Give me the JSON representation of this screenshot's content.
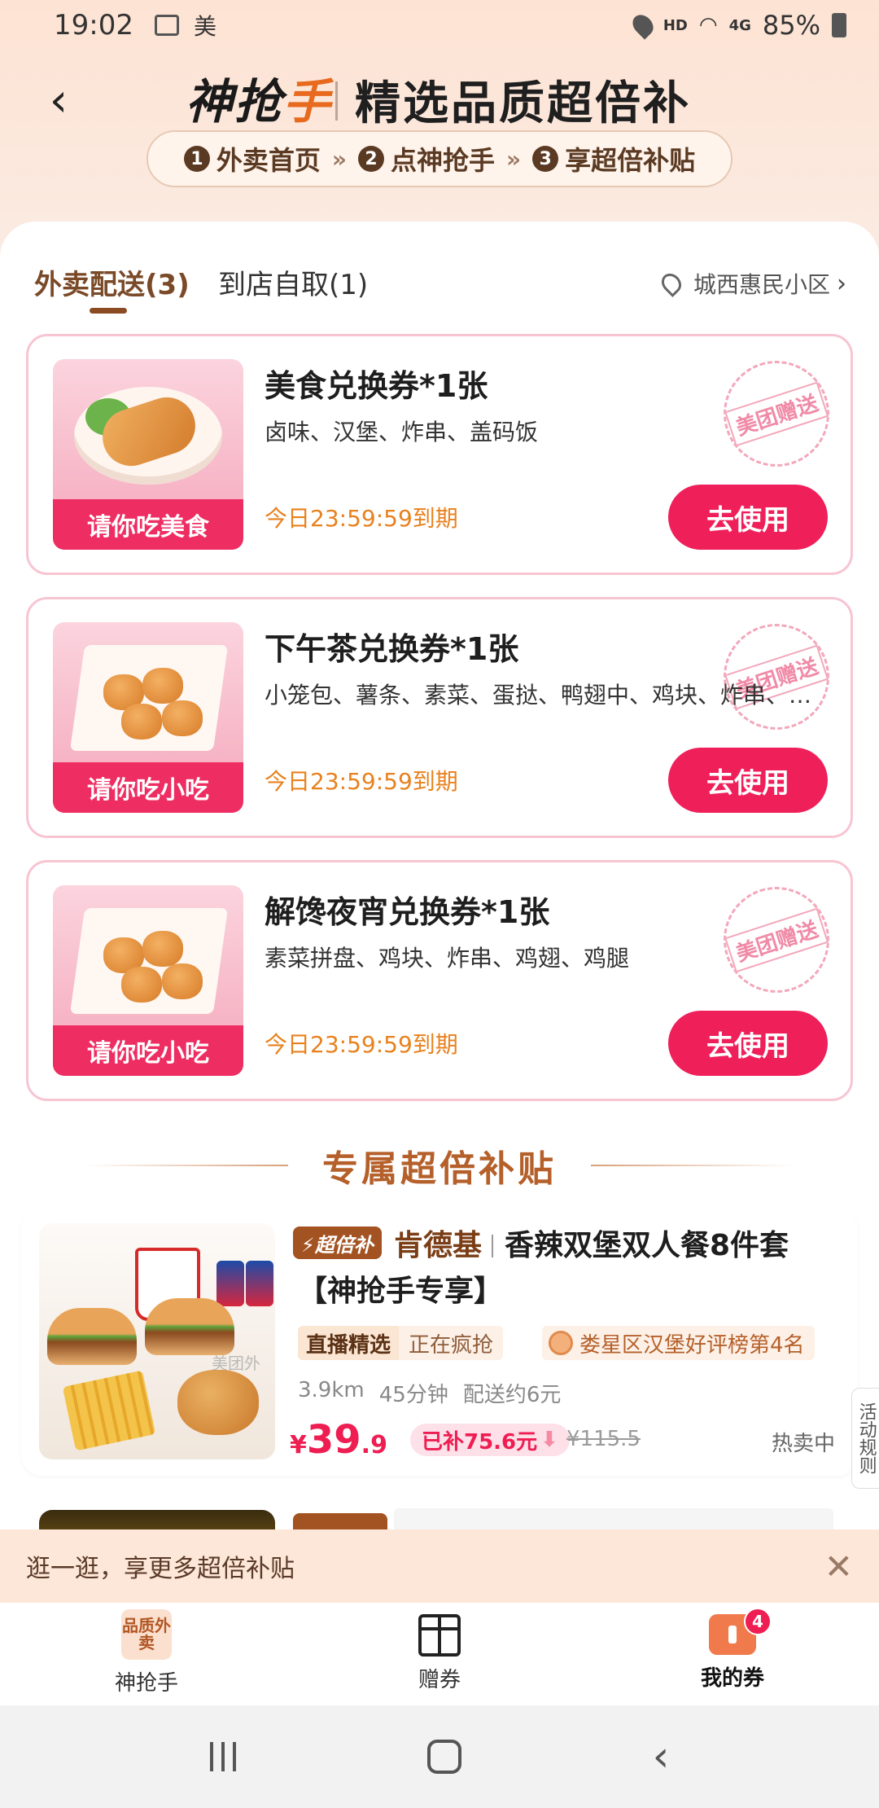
{
  "status_bar": {
    "time": "19:02",
    "app_label": "美",
    "hd": "HD",
    "network": "4G",
    "battery": "85%"
  },
  "header": {
    "back_icon": "chevron-left-icon",
    "brand_a": "神抢",
    "brand_b": "手",
    "title": "精选品质超倍补"
  },
  "steps": [
    {
      "num": "1",
      "label": "外卖首页"
    },
    {
      "num": "2",
      "label": "点神抢手"
    },
    {
      "num": "3",
      "label": "享超倍补贴"
    }
  ],
  "step_separator": "»",
  "tabs": {
    "delivery": "外卖配送(3)",
    "pickup": "到店自取(1)",
    "location": "城西惠民小区"
  },
  "coupons": [
    {
      "title": "美食兑换券*1张",
      "desc": "卤味、汉堡、炸串、盖码饭",
      "thumb_label": "请你吃美食",
      "expire": "今日23:59:59到期",
      "button": "去使用",
      "stamp": "美团赠送"
    },
    {
      "title": "下午茶兑换券*1张",
      "desc": "小笼包、薯条、素菜、蛋挞、鸭翅中、鸡块、炸串、…",
      "thumb_label": "请你吃小吃",
      "expire": "今日23:59:59到期",
      "button": "去使用",
      "stamp": "美团赠送"
    },
    {
      "title": "解馋夜宵兑换券*1张",
      "desc": "素菜拼盘、鸡块、炸串、鸡翅、鸡腿",
      "thumb_label": "请你吃小吃",
      "expire": "今日23:59:59到期",
      "button": "去使用",
      "stamp": "美团赠送"
    }
  ],
  "section_title": "专属超倍补贴",
  "deal": {
    "badge": "⚡超倍补",
    "shop": "肯德基",
    "name_line1": "香辣双堡双人餐8件套",
    "name_line2": "【神抢手专享】",
    "tag_live_a": "直播精选",
    "tag_live_b": "正在疯抢",
    "rank": "娄星区汉堡好评榜第4名",
    "distance": "3.9km",
    "time": "45分钟",
    "delivery_fee": "配送约6元",
    "price_currency": "¥",
    "price_int": "39",
    "price_dec": ".9",
    "saved": "已补75.6元",
    "original_price": "¥115.5",
    "hot": "热卖中",
    "watermark": "美团外"
  },
  "rules_tab": "活动规则",
  "promo": {
    "text": "逛一逛，享更多超倍补贴",
    "close": "✕"
  },
  "bottom_nav": {
    "item1_icon_text": "品质外卖",
    "item1": "神抢手",
    "item2": "赠券",
    "item3": "我的券",
    "badge": "4"
  }
}
